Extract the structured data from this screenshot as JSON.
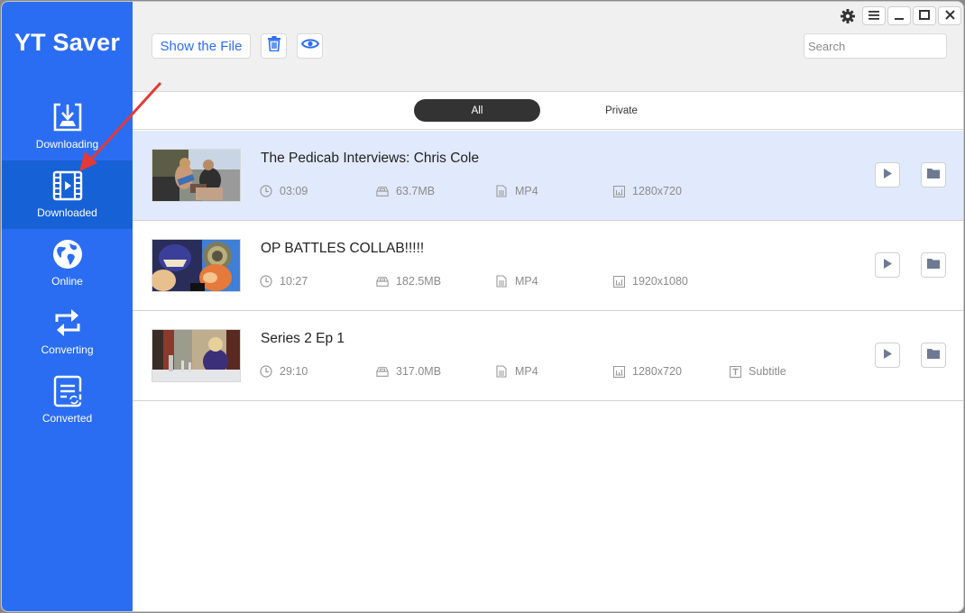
{
  "app": {
    "title": "YT Saver",
    "accent_color": "#2b6df2",
    "sidebar_active_color": "#1761d6"
  },
  "sidebar": {
    "items": [
      {
        "label": "Downloading",
        "icon": "download-tray-icon",
        "active": false
      },
      {
        "label": "Downloaded",
        "icon": "film-play-icon",
        "active": true
      },
      {
        "label": "Online",
        "icon": "globe-icon",
        "active": false
      },
      {
        "label": "Converting",
        "icon": "convert-arrows-icon",
        "active": false
      },
      {
        "label": "Converted",
        "icon": "converted-doc-icon",
        "active": false
      }
    ]
  },
  "toolbar": {
    "show_file_label": "Show the File",
    "delete_icon": "trash-icon",
    "view_icon": "eye-icon",
    "search_placeholder": "Search",
    "search_value": ""
  },
  "window_controls": {
    "settings_icon": "gear-icon",
    "menu_icon": "hamburger-icon",
    "minimize_icon": "minimize-icon",
    "maximize_icon": "maximize-icon",
    "close_icon": "close-icon"
  },
  "tabs": [
    {
      "label": "All",
      "active": true
    },
    {
      "label": "Private",
      "active": false
    }
  ],
  "videos": [
    {
      "title": "The Pedicab Interviews: Chris Cole",
      "duration": "03:09",
      "size": "63.7MB",
      "format": "MP4",
      "resolution": "1280x720",
      "subtitle": null,
      "selected": true
    },
    {
      "title": "OP BATTLES COLLAB!!!!!",
      "duration": "10:27",
      "size": "182.5MB",
      "format": "MP4",
      "resolution": "1920x1080",
      "subtitle": null,
      "selected": false
    },
    {
      "title": "Series 2 Ep 1",
      "duration": "29:10",
      "size": "317.0MB",
      "format": "MP4",
      "resolution": "1280x720",
      "subtitle": "Subtitle",
      "selected": false
    }
  ],
  "annotation": {
    "arrow_color": "#e53935",
    "points_to": "Downloaded"
  }
}
